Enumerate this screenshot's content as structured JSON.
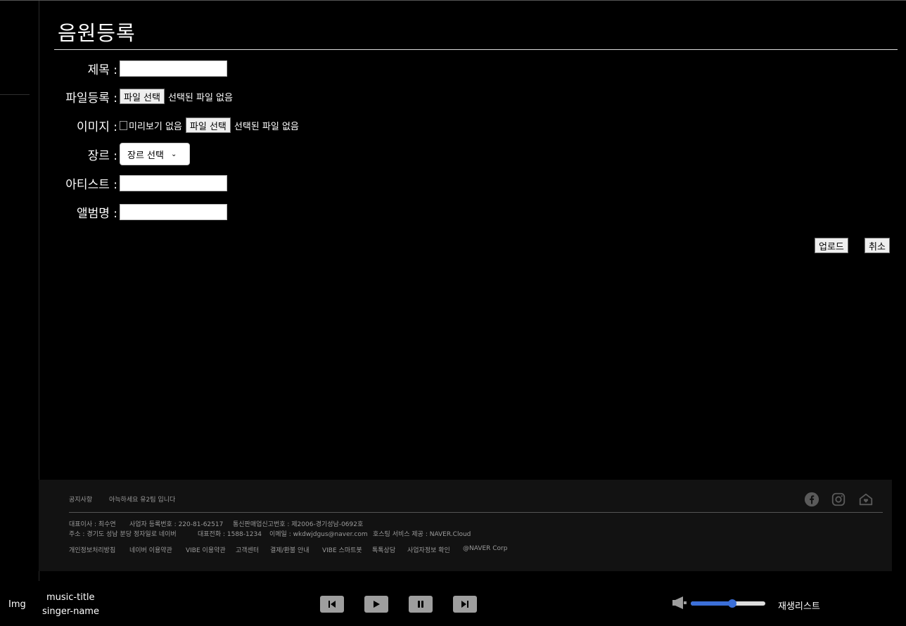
{
  "page": {
    "title": "음원등록"
  },
  "form": {
    "title_label": "제목 :",
    "file_label": "파일등록 :",
    "image_label": "이미지 :",
    "genre_label": "장르 :",
    "artist_label": "아티스트 :",
    "album_label": "앨범명 :",
    "file_button": "파일 선택",
    "no_file_text": "선택된 파일 없음",
    "image_alt": "미리보기 없음",
    "genre_selected": "장르 선택"
  },
  "actions": {
    "upload": "업로드",
    "cancel": "취소"
  },
  "footer": {
    "links_top": [
      "공지사항",
      "아늑하세요 유2팀 입니다"
    ],
    "info_line1": [
      "대표이사 : 최수연",
      "사업자 등록번호 : 220-81-62517",
      "통신판매업신고번호 : 제2006-경기성남-0692호"
    ],
    "info_line2": [
      "주소 : 경기도 성남 분당 정자일로 네이버",
      "대표전화 : 1588-1234",
      "이메일 : wkdwjdgus@naver.com",
      "호스팅 서비스 제공 : NAVER.Cloud"
    ],
    "links_bottom": [
      "개인정보처리방침",
      "네이버 이용약관",
      "VIBE 이용약관",
      "고객센터",
      "결제/환불 안내",
      "VIBE 스마트봇",
      "톡톡상담",
      "사업자정보 확인",
      "@NAVER Corp"
    ],
    "social_icons": [
      "facebook-icon",
      "instagram-icon",
      "home-icon"
    ]
  },
  "player": {
    "img": "Img",
    "music_title": "music-title",
    "singer_name": "singer-name",
    "volume": 0.56,
    "playlist": "재생리스트",
    "controls": [
      "prev-icon",
      "play-icon",
      "pause-icon",
      "next-icon"
    ],
    "accent": "#3b6fd8"
  }
}
